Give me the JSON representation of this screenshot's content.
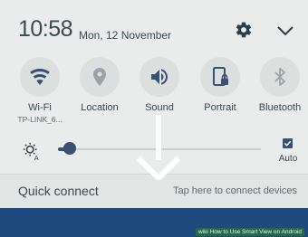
{
  "status": {
    "time": "10:58",
    "date": "Mon, 12 November",
    "settings_icon": "gear-icon",
    "expand_icon": "chevron-down-icon"
  },
  "quick_settings": [
    {
      "label": "Wi-Fi",
      "sub": "TP-LINK_6...",
      "icon": "wifi-icon",
      "active": true
    },
    {
      "label": "Location",
      "icon": "location-icon",
      "active": false
    },
    {
      "label": "Sound",
      "icon": "sound-icon",
      "active": true
    },
    {
      "label": "Portrait",
      "icon": "portrait-lock-icon",
      "active": true
    },
    {
      "label": "Bluetooth",
      "icon": "bluetooth-icon",
      "active": false
    }
  ],
  "brightness": {
    "level": 0.06,
    "auto_label": "Auto",
    "auto_checked": true
  },
  "quick_connect": {
    "title": "Quick connect",
    "hint": "Tap here to connect devices"
  },
  "watermark": "wiki How to Use Smart View on Android",
  "colors": {
    "accent": "#3a4f72",
    "active_icon": "#3a4f72",
    "inactive_icon": "#9aa4a8",
    "background": "#e9ecea"
  }
}
